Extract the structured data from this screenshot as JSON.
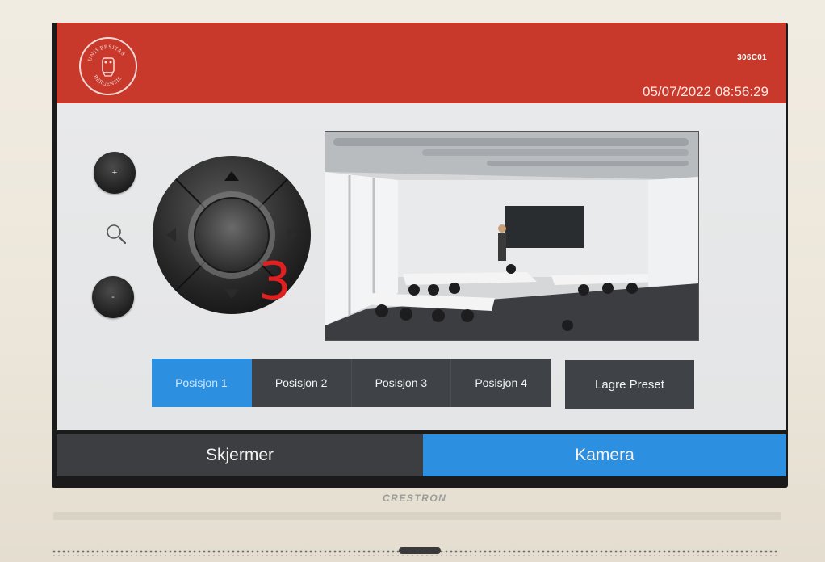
{
  "header": {
    "room_code": "306C01",
    "datetime": "05/07/2022 08:56:29",
    "logo_icon": "universitas-bergensis-seal",
    "logo_text": "UNIVERSITAS BERGENSIS"
  },
  "camera": {
    "zoom_in_label": "+",
    "zoom_out_label": "-",
    "zoom_icon": "magnifier-icon",
    "dpad_icons": [
      "arrow-up-icon",
      "arrow-down-icon",
      "arrow-left-icon",
      "arrow-right-icon"
    ],
    "overlay_number": "3"
  },
  "positions": {
    "items": [
      "Posisjon 1",
      "Posisjon 2",
      "Posisjon 3",
      "Posisjon 4"
    ],
    "active_index": 0,
    "save_label": "Lagre Preset"
  },
  "tabs": {
    "screens": "Skjermer",
    "camera": "Kamera",
    "active": "camera"
  },
  "device": {
    "brand": "CRESTRON"
  },
  "colors": {
    "header_red": "#c8392c",
    "accent_blue": "#2d8fe0",
    "button_dark": "#3f4348"
  }
}
